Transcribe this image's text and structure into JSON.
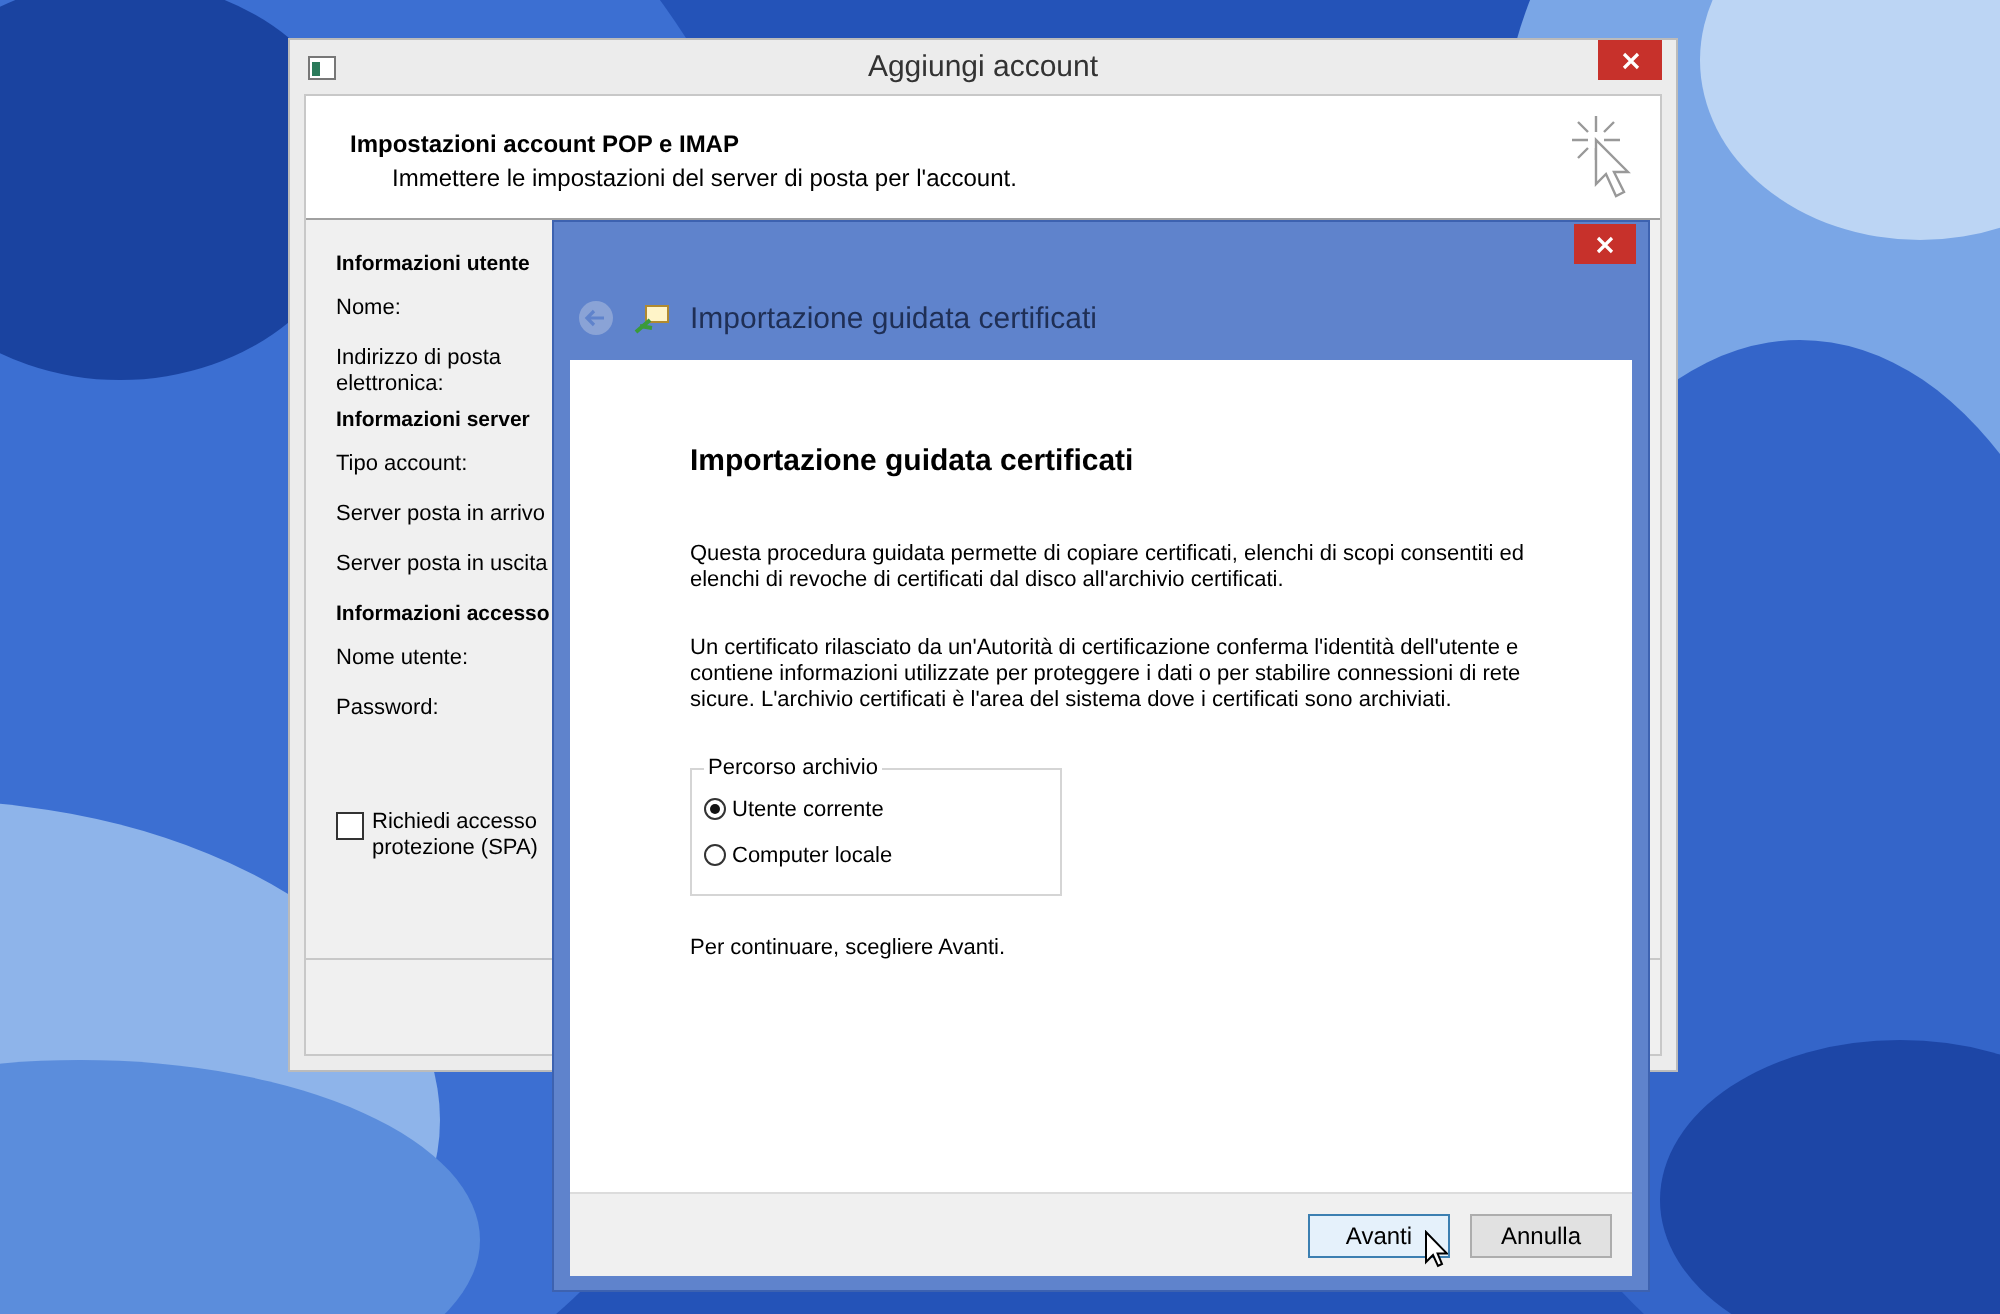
{
  "back_window": {
    "title": "Aggiungi account",
    "header_title": "Impostazioni account POP e IMAP",
    "header_subtitle": "Immettere le impostazioni del server di posta per l'account.",
    "rows": [
      {
        "kind": "section",
        "text": "Informazioni utente"
      },
      {
        "kind": "label",
        "text": "Nome:"
      },
      {
        "kind": "label",
        "text": "Indirizzo di posta elettronica:"
      },
      {
        "kind": "section",
        "text": "Informazioni server"
      },
      {
        "kind": "label",
        "text": "Tipo account:"
      },
      {
        "kind": "label",
        "text": "Server posta in arrivo"
      },
      {
        "kind": "label",
        "text": "Server posta in uscita"
      },
      {
        "kind": "section",
        "text": "Informazioni accesso"
      },
      {
        "kind": "label",
        "text": "Nome utente:"
      },
      {
        "kind": "label",
        "text": "Password:"
      }
    ],
    "checkbox": {
      "lines": [
        "Richiedi accesso",
        "protezione (SPA)"
      ],
      "checked": false
    }
  },
  "dialog": {
    "title": "Importazione guidata certificati",
    "heading": "Importazione guidata certificati",
    "paragraphs": [
      "Questa procedura guidata permette di copiare certificati, elenchi di scopi consentiti ed elenchi di revoche di certificati dal disco all'archivio certificati.",
      "Un certificato rilasciato da un'Autorità di certificazione conferma l'identità dell'utente e contiene informazioni utilizzate per proteggere i dati o per stabilire connessioni di rete sicure. L'archivio certificati è l'area del sistema dove i certificati sono archiviati."
    ],
    "group": {
      "legend": "Percorso archivio",
      "options": [
        {
          "label": "Utente corrente",
          "selected": true
        },
        {
          "label": "Computer locale",
          "selected": false
        }
      ]
    },
    "footer_text": "Per continuare, scegliere Avanti.",
    "buttons": [
      {
        "label": "Avanti",
        "default": true
      },
      {
        "label": "Annulla",
        "default": false
      }
    ]
  }
}
